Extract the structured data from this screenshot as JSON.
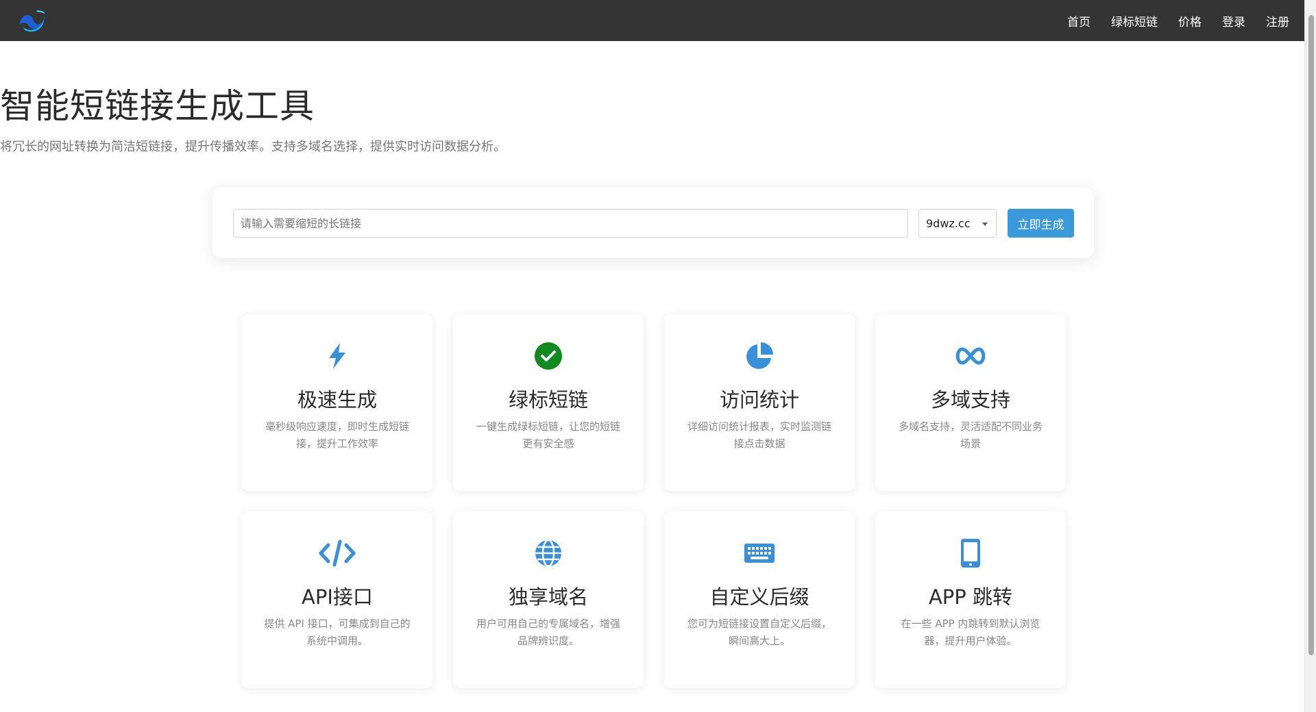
{
  "nav": {
    "logo": "wave-logo-icon",
    "links": [
      "首页",
      "绿标短链",
      "价格",
      "登录",
      "注册"
    ]
  },
  "hero": {
    "title": "智能短链接生成工具",
    "subtitle": "将冗长的网址转换为简洁短链接，提升传播效率。支持多域名选择，提供实时访问数据分析。"
  },
  "shortener": {
    "placeholder": "请输入需要缩短的长链接",
    "url_value": "",
    "domain_selected": "9dwz.cc",
    "button_label": "立即生成"
  },
  "features": [
    {
      "icon": "bolt-icon",
      "title": "极速生成",
      "desc": "毫秒级响应速度，即时生成短链接，提升工作效率",
      "color": "#3a8fd9"
    },
    {
      "icon": "check-circle-icon",
      "title": "绿标短链",
      "desc": "一键生成绿标短链，让您的短链更有安全感",
      "color": "#0f8a1f"
    },
    {
      "icon": "pie-chart-icon",
      "title": "访问统计",
      "desc": "详细访问统计报表，实时监测链接点击数据",
      "color": "#3a8fd9"
    },
    {
      "icon": "infinity-icon",
      "title": "多域支持",
      "desc": "多域名支持，灵活适配不同业务场景",
      "color": "#3a8fd9"
    },
    {
      "icon": "code-icon",
      "title": "API接口",
      "desc": "提供 API 接口，可集成到自己的系统中调用。",
      "color": "#3a8fd9"
    },
    {
      "icon": "globe-icon",
      "title": "独享域名",
      "desc": "用户可用自己的专属域名，增强品牌辨识度。",
      "color": "#3a8fd9"
    },
    {
      "icon": "keyboard-icon",
      "title": "自定义后缀",
      "desc": "您可为短链接设置自定义后缀，瞬间高大上。",
      "color": "#3a8fd9"
    },
    {
      "icon": "mobile-icon",
      "title": "APP 跳转",
      "desc": "在一些 APP 内跳转到默认浏览器，提升用户体验。",
      "color": "#3a8fd9"
    }
  ]
}
